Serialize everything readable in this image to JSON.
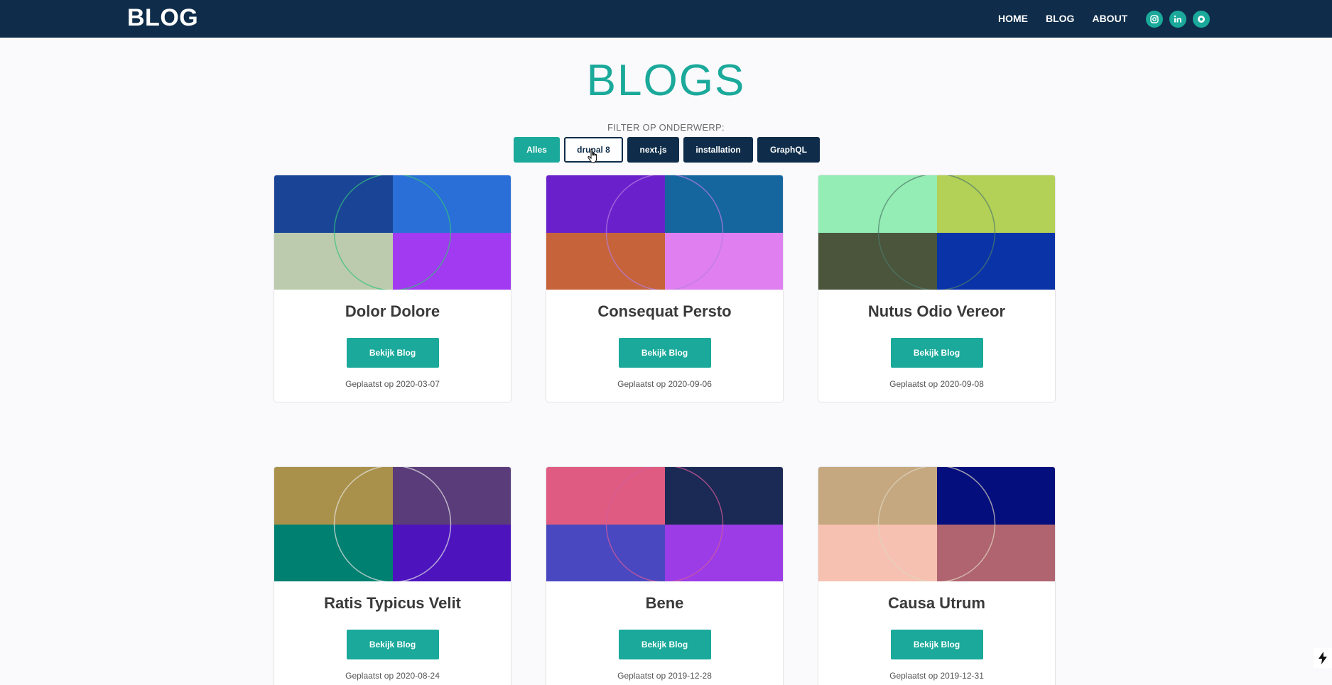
{
  "header": {
    "brand": "BLOG",
    "nav": [
      {
        "label": "HOME"
      },
      {
        "label": "BLOG"
      },
      {
        "label": "ABOUT"
      }
    ],
    "socials": [
      "instagram-icon",
      "linkedin-icon",
      "github-icon"
    ]
  },
  "page": {
    "title": "BLOGS",
    "filter_label": "FILTER OP ONDERWERP:",
    "filters": [
      {
        "label": "Alles",
        "state": "active"
      },
      {
        "label": "drupal 8",
        "state": "hover"
      },
      {
        "label": "next.js",
        "state": "default"
      },
      {
        "label": "installation",
        "state": "default"
      },
      {
        "label": "GraphQL",
        "state": "default"
      }
    ]
  },
  "colors": {
    "header_bg": "#0f2d4a",
    "accent": "#1aa99a"
  },
  "cards": [
    {
      "title": "Dolor Dolore",
      "button": "Bekijk Blog",
      "date": "Geplaatst op 2020-03-07",
      "quadrants": [
        "#1a4596",
        "#2a6fd8",
        "#bccbad",
        "#a13af0"
      ],
      "ring": "#35c17a"
    },
    {
      "title": "Consequat Persto",
      "button": "Bekijk Blog",
      "date": "Geplaatst op 2020-09-06",
      "quadrants": [
        "#6a21cc",
        "#15669e",
        "#c6633a",
        "#e07ff0"
      ],
      "ring": "#b77ee0"
    },
    {
      "title": "Nutus Odio Vereor",
      "button": "Bekijk Blog",
      "date": "Geplaatst op 2020-09-08",
      "quadrants": [
        "#94edb4",
        "#b3d057",
        "#4a553c",
        "#0a33a8"
      ],
      "ring": "#4e7a6a"
    },
    {
      "title": "Ratis Typicus Velit",
      "button": "Bekijk Blog",
      "date": "Geplaatst op 2020-08-24",
      "quadrants": [
        "#aa914b",
        "#5a3c7a",
        "#008070",
        "#4d14be"
      ],
      "ring": "#e6e6e6"
    },
    {
      "title": "Bene",
      "button": "Bekijk Blog",
      "date": "Geplaatst op 2019-12-28",
      "quadrants": [
        "#e05b82",
        "#1b2955",
        "#4a48c0",
        "#9b3ce6"
      ],
      "ring": "#d35c9a"
    },
    {
      "title": "Causa Utrum",
      "button": "Bekijk Blog",
      "date": "Geplaatst op 2019-12-31",
      "quadrants": [
        "#c5a880",
        "#040e7c",
        "#f6c1b0",
        "#b06470"
      ],
      "ring": "#e0d5c0"
    }
  ]
}
